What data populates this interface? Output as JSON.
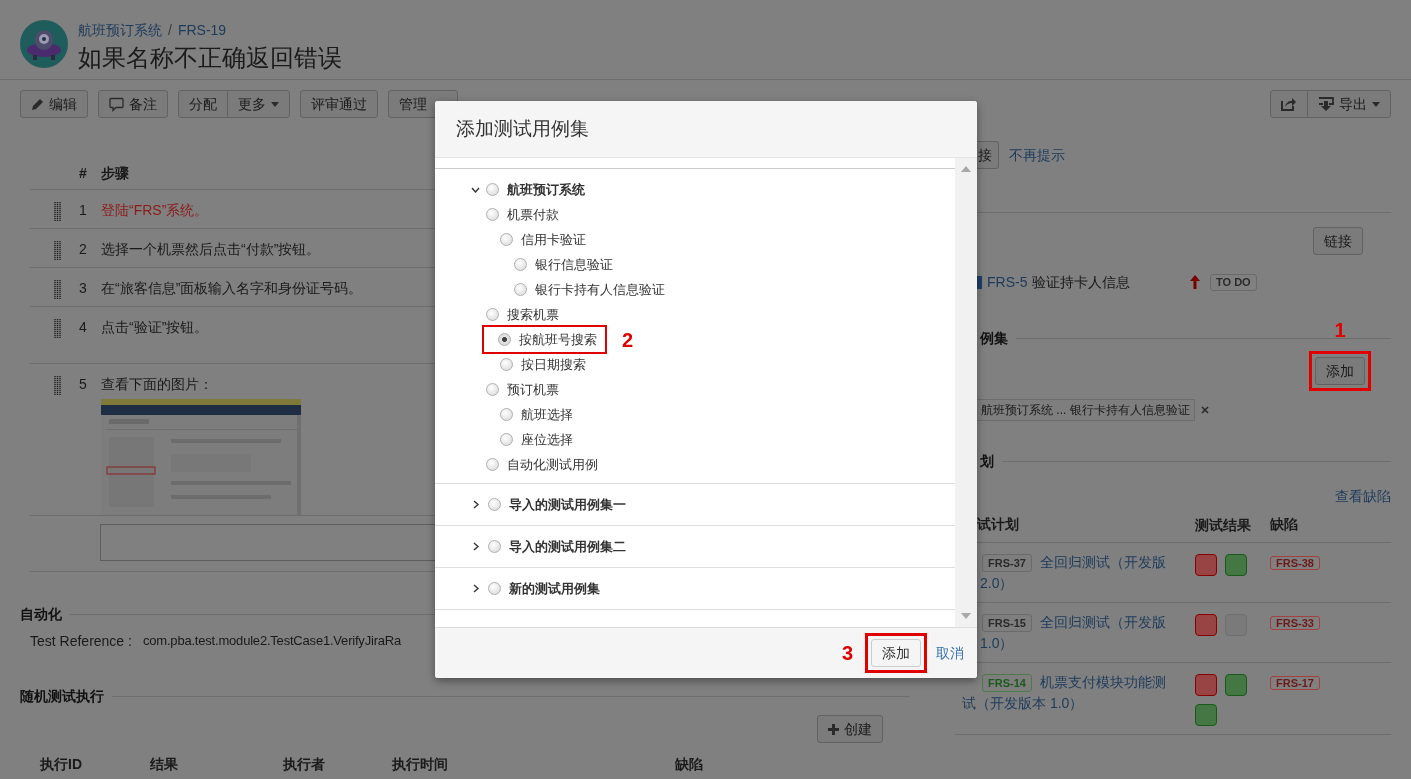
{
  "header": {
    "breadcrumb": {
      "items": [
        "航班预订系统",
        "FRS-19"
      ],
      "separator": "/"
    },
    "title": "如果名称不正确返回错误"
  },
  "toolbar": {
    "left": [
      [
        {
          "kind": "edit",
          "label": "编辑"
        }
      ],
      [
        {
          "kind": "comment",
          "label": "备注"
        }
      ],
      [
        {
          "kind": "plain",
          "label": "分配"
        },
        {
          "kind": "dropdown",
          "label": "更多"
        }
      ],
      [
        {
          "kind": "plain",
          "label": "评审通过"
        }
      ],
      [
        {
          "kind": "plain",
          "label": "管理"
        }
      ]
    ],
    "right": [
      [
        {
          "kind": "share"
        },
        {
          "kind": "export",
          "label": "导出"
        }
      ]
    ]
  },
  "steps": {
    "columns": [
      "#",
      "步骤"
    ],
    "rows": [
      {
        "number": "1",
        "text": "登陆“FRS”系统。",
        "color": "#8b1a1a"
      },
      {
        "number": "2",
        "text": "选择一个机票然后点击“付款”按钮。",
        "color": "#1a1a1a"
      },
      {
        "number": "3",
        "text": "在“旅客信息”面板输入名字和身份证号码。",
        "color": "#1a1a1a"
      },
      {
        "number": "4",
        "text": "点击“验证”按钮。",
        "color": "#1a1a1a"
      },
      {
        "number": "5",
        "text": "查看下面的图片：",
        "color": "#1a1a1a"
      }
    ]
  },
  "automation": {
    "heading": "自动化",
    "label": "Test Reference :",
    "value": "com.pba.test.module2.TestCase1.VerifyJiraRa"
  },
  "executions": {
    "heading": "随机测试执行",
    "create_button": "创建",
    "columns": [
      "执行ID",
      "结果",
      "执行者",
      "执行时间",
      "缺陷"
    ]
  },
  "sidebar": {
    "notice": {
      "button": "接",
      "dismiss": "不再提示"
    },
    "links": {
      "button": "链接",
      "items": [
        {
          "key": "FRS-5",
          "summary": "验证持卡人信息",
          "high_priority": true,
          "status": "TO DO"
        }
      ]
    },
    "test_sets": {
      "heading": "例集",
      "add_button": {
        "label": "添加",
        "callout": "1"
      },
      "tags": [
        "航班预订系统 ... 银行卡持有人信息验证"
      ]
    },
    "test_plans": {
      "heading": "划",
      "link": "查看缺陷",
      "columns": [
        "试计划",
        "测试结果",
        "缺陷"
      ],
      "rows": [
        {
          "key": "FRS-37",
          "done": false,
          "name_lines": [
            "全回归测试（开发版",
            "2.0）"
          ],
          "results": [
            {
              "executed": true,
              "passed": false
            },
            {
              "executed": true,
              "passed": true
            }
          ],
          "defect": "FRS-38"
        },
        {
          "key": "FRS-15",
          "done": false,
          "name_lines": [
            "全回归测试（开发版",
            "1.0）"
          ],
          "results": [
            {
              "executed": true,
              "passed": false
            },
            {
              "executed": false
            }
          ],
          "defect": "FRS-33"
        },
        {
          "key": "FRS-14",
          "done": true,
          "name_lines": [
            "机票支付模块功能测",
            "试（开发版本 1.0）"
          ],
          "results": [
            {
              "executed": true,
              "passed": false
            },
            {
              "executed": true,
              "passed": true
            },
            {
              "executed": true,
              "passed": true
            }
          ],
          "defect": "FRS-17"
        }
      ]
    }
  },
  "modal": {
    "title": "添加测试用例集",
    "tree": [
      {
        "label": "航班预订系统",
        "expanded": true,
        "selected": false,
        "children": [
          {
            "label": "机票付款",
            "selected": false,
            "children": [
              {
                "label": "信用卡验证",
                "selected": false,
                "children": [
                  {
                    "label": "银行信息验证",
                    "selected": false
                  },
                  {
                    "label": "银行卡持有人信息验证",
                    "selected": false
                  }
                ]
              }
            ]
          },
          {
            "label": "搜索机票",
            "selected": false,
            "children": [
              {
                "label": "按航班号搜索",
                "selected": true,
                "callout": "2"
              },
              {
                "label": "按日期搜索",
                "selected": false
              }
            ]
          },
          {
            "label": "预订机票",
            "selected": false,
            "children": [
              {
                "label": "航班选择",
                "selected": false
              },
              {
                "label": "座位选择",
                "selected": false
              }
            ]
          },
          {
            "label": "自动化测试用例",
            "selected": false
          }
        ]
      },
      {
        "label": "导入的测试用例集一",
        "expanded": false,
        "selected": false
      },
      {
        "label": "导入的测试用例集二",
        "expanded": false,
        "selected": false
      },
      {
        "label": "新的测试用例集",
        "expanded": false,
        "selected": false
      }
    ],
    "add_button": {
      "label": "添加",
      "callout": "3"
    },
    "cancel": "取消"
  }
}
